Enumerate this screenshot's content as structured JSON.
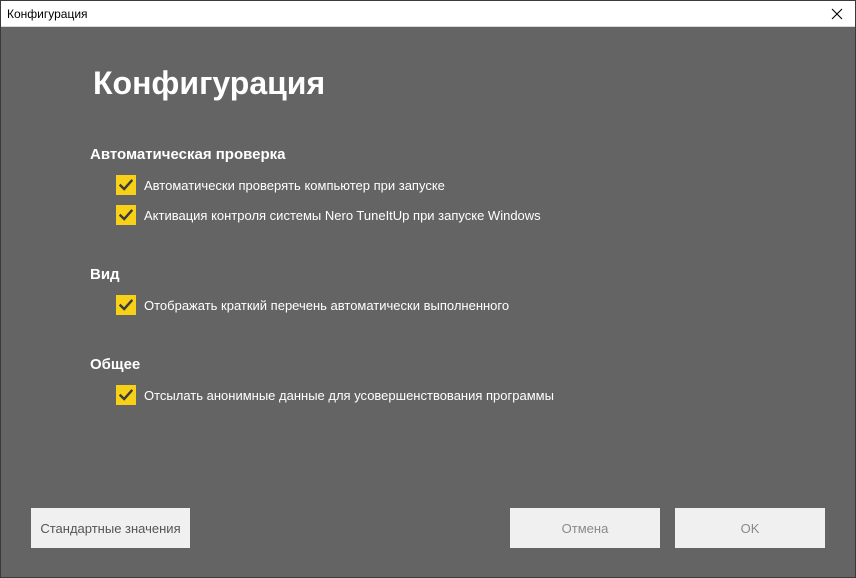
{
  "window": {
    "title": "Конфигурация"
  },
  "page": {
    "heading": "Конфигурация"
  },
  "sections": {
    "auto_check": {
      "title": "Автоматическая проверка",
      "options": [
        {
          "label": "Автоматически проверять компьютер при запуске",
          "checked": true
        },
        {
          "label": "Активация контроля системы Nero TuneItUp при запуске Windows",
          "checked": true
        }
      ]
    },
    "view": {
      "title": "Вид",
      "options": [
        {
          "label": "Отображать краткий перечень автоматически выполненного",
          "checked": true
        }
      ]
    },
    "general": {
      "title": "Общее",
      "options": [
        {
          "label": "Отсылать анонимные данные для усовершенствования программы",
          "checked": true
        }
      ]
    }
  },
  "buttons": {
    "defaults": "Стандартные значения",
    "cancel": "Отмена",
    "ok": "OK"
  },
  "colors": {
    "background": "#646464",
    "checkbox": "#f7d117",
    "checkmark": "#3a3a3a",
    "button": "#f0f0f0"
  },
  "icons": {
    "close": "close-icon",
    "check": "checkmark-icon"
  }
}
